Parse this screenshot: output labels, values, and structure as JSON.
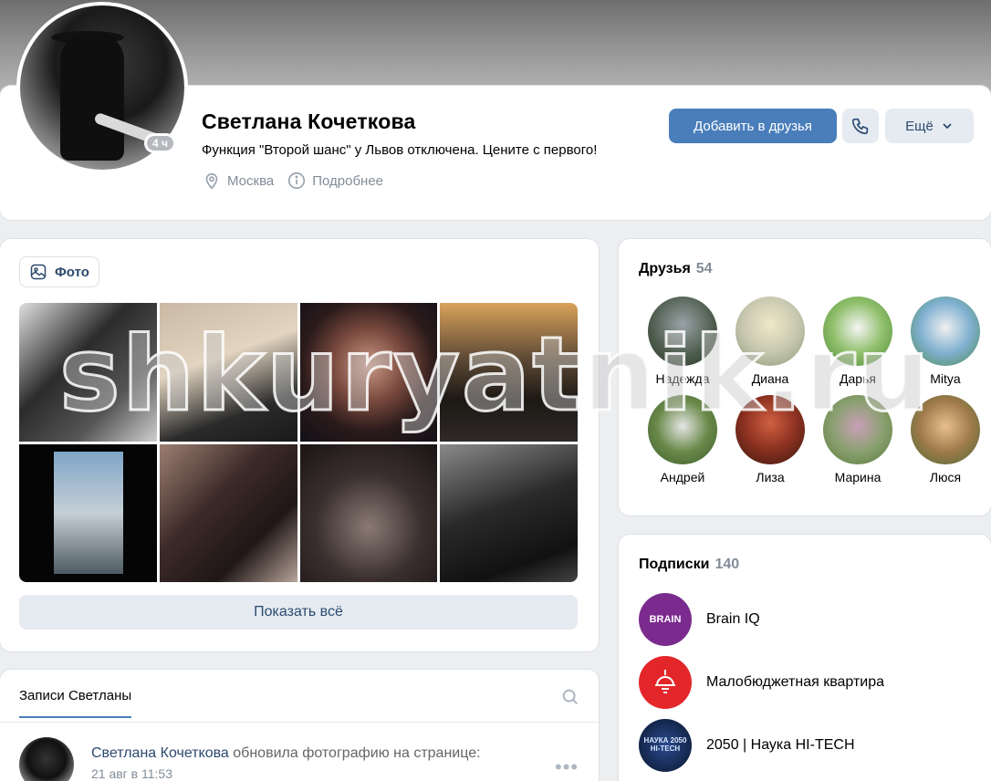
{
  "profile": {
    "name": "Светлана Кочеткова",
    "status": "Функция \"Второй шанс\" у Львов отключена. Цените с первого!",
    "last_seen_badge": "4 ч",
    "city": "Москва",
    "details_label": "Подробнее",
    "add_friend_label": "Добавить в друзья",
    "more_label": "Ещё"
  },
  "photos": {
    "tab_label": "Фото",
    "show_all_label": "Показать всё",
    "count_shown": 8
  },
  "watermark": "shkuryatnik.ru",
  "friends": {
    "title": "Друзья",
    "count": "54",
    "items": [
      {
        "name": "Надежда"
      },
      {
        "name": "Диана"
      },
      {
        "name": "Дарья"
      },
      {
        "name": "Mitya"
      },
      {
        "name": "Андрей"
      },
      {
        "name": "Лиза"
      },
      {
        "name": "Марина"
      },
      {
        "name": "Люся"
      }
    ]
  },
  "subscriptions": {
    "title": "Подписки",
    "count": "140",
    "items": [
      {
        "name": "Brain IQ",
        "logo_text": "BRAIN"
      },
      {
        "name": "Малобюджетная квартира",
        "logo_text": ""
      },
      {
        "name": "2050 | Наука HI-TECH",
        "logo_text": "НАУКА 2050 HI-TECH"
      }
    ]
  },
  "wall": {
    "tab_label": "Записи Светланы",
    "post": {
      "author": "Светлана Кочеткова",
      "action": "обновила фотографию на странице:",
      "date": "21 авг в 11:53"
    }
  },
  "colors": {
    "accent": "#4a7ebb",
    "secondary_button": "#e5ebf1",
    "link": "#2c4a6e",
    "muted": "#818c99"
  }
}
